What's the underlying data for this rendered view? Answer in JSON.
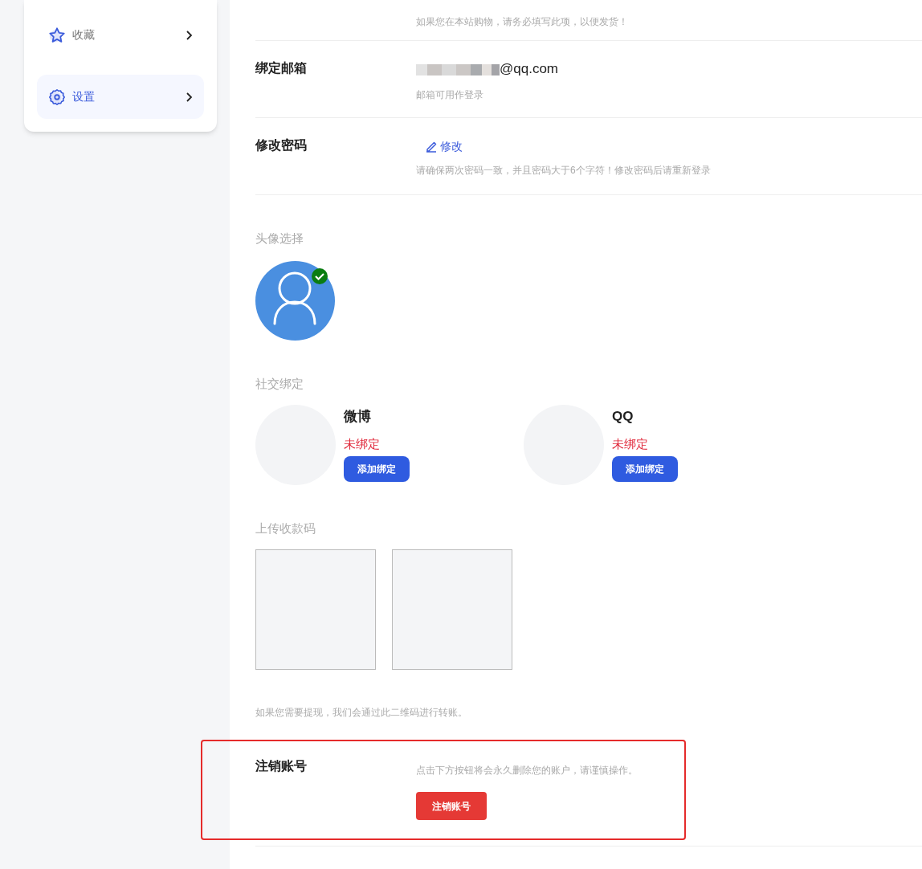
{
  "sidebar": {
    "items": [
      {
        "label": "收藏",
        "kind": "favorites",
        "selected": false
      },
      {
        "label": "设置",
        "kind": "settings",
        "selected": true
      }
    ]
  },
  "address_hint": "如果您在本站购物，请务必填写此项，以便发货！",
  "email": {
    "label": "绑定邮箱",
    "value": "@qq.com",
    "hint": "邮箱可用作登录"
  },
  "password": {
    "label": "修改密码",
    "action": "修改",
    "hint": "请确保两次密码一致，并且密码大于6个字符！修改密码后请重新登录"
  },
  "avatar": {
    "heading": "头像选择",
    "options": [
      {
        "selected": true
      }
    ]
  },
  "social": {
    "heading": "社交绑定",
    "accounts": [
      {
        "name": "微博",
        "status": "未绑定",
        "bound": false,
        "button": "添加绑定"
      },
      {
        "name": "QQ",
        "status": "未绑定",
        "bound": false,
        "button": "添加绑定"
      }
    ]
  },
  "payment_codes": {
    "heading": "上传收款码",
    "slots": [
      {
        "kind": "empty"
      },
      {
        "kind": "empty"
      }
    ],
    "hint": "如果您需要提现，我们会通过此二维码进行转账。"
  },
  "delete_account": {
    "label": "注销账号",
    "hint": "点击下方按钮将会永久删除您的账户，请谨慎操作。",
    "button": "注销账号",
    "highlighted": true
  }
}
